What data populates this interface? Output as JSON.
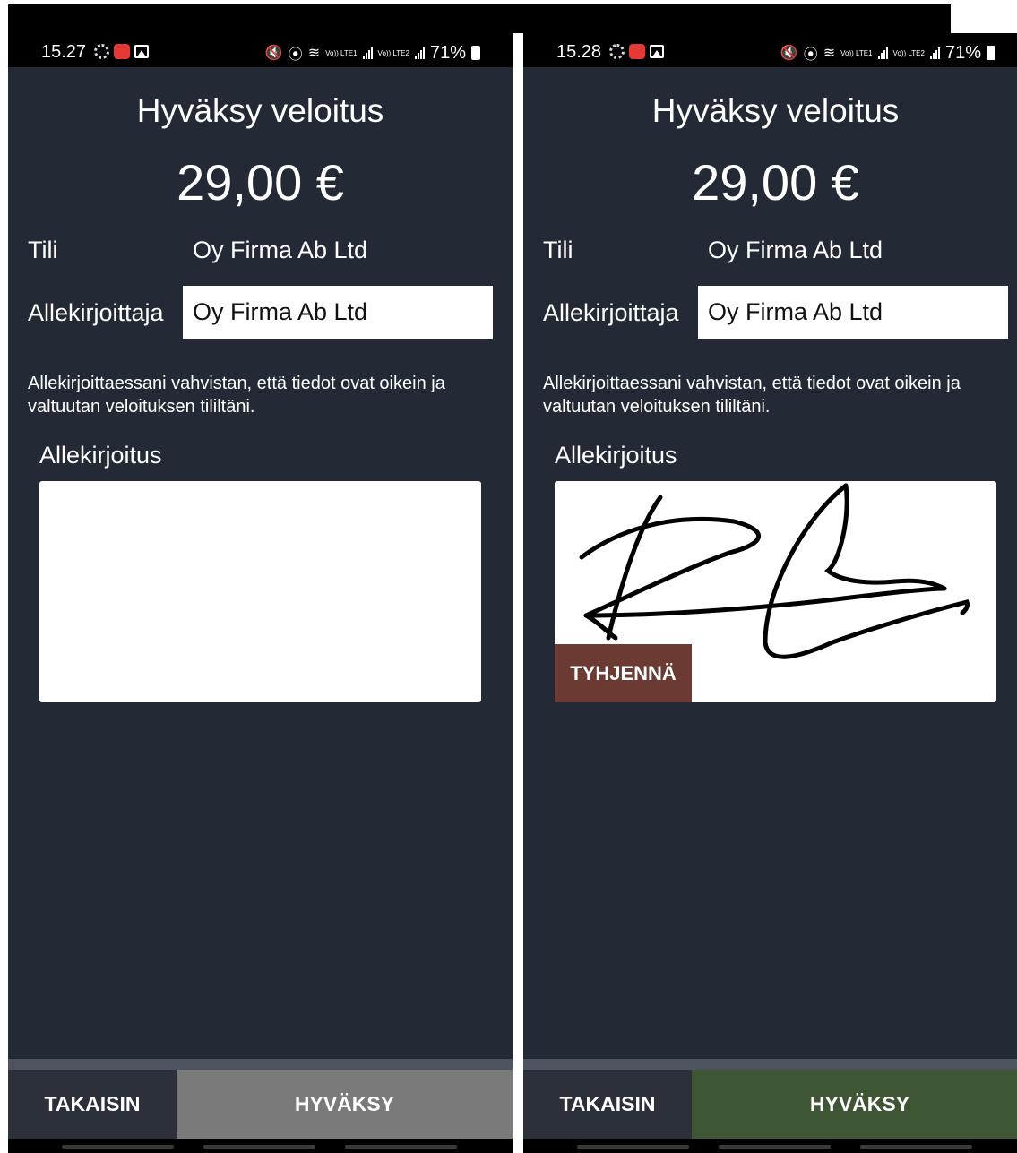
{
  "screens": [
    {
      "status": {
        "time": "15.27",
        "battery": "71%",
        "sim1": "Vo)) LTE1",
        "sim2": "Vo)) LTE2"
      },
      "title": "Hyväksy veloitus",
      "amount": "29,00 €",
      "account_label": "Tili",
      "account_value": "Oy Firma Ab Ltd",
      "signer_label": "Allekirjoittaja",
      "signer_value": "Oy Firma Ab Ltd",
      "consent_text": "Allekirjoittaessani vahvistan, että tiedot ovat oikein ja valtuutan veloituksen tililtäni.",
      "signature_label": "Allekirjoitus",
      "signature_present": false,
      "back_label": "TAKAISIN",
      "accept_label": "HYVÄKSY",
      "accept_enabled": false,
      "accept_color": "#7a7a7a"
    },
    {
      "status": {
        "time": "15.28",
        "battery": "71%",
        "sim1": "Vo)) LTE1",
        "sim2": "Vo)) LTE2"
      },
      "title": "Hyväksy veloitus",
      "amount": "29,00 €",
      "account_label": "Tili",
      "account_value": "Oy Firma Ab Ltd",
      "signer_label": "Allekirjoittaja",
      "signer_value": "Oy Firma Ab Ltd",
      "consent_text": "Allekirjoittaessani vahvistan, että tiedot ovat oikein ja valtuutan veloituksen tililtäni.",
      "signature_label": "Allekirjoitus",
      "signature_present": true,
      "clear_label": "TYHJENNÄ",
      "back_label": "TAKAISIN",
      "accept_label": "HYVÄKSY",
      "accept_enabled": true,
      "accept_color": "#3f5635"
    }
  ],
  "colors": {
    "background": "#242a35",
    "clear_button": "#6a3a33",
    "back_button": "#2b303b"
  },
  "icons": [
    "gear-icon",
    "red-app-icon",
    "gallery-icon",
    "mute-icon",
    "location-icon",
    "wifi-icon",
    "signal-icon",
    "battery-icon"
  ]
}
